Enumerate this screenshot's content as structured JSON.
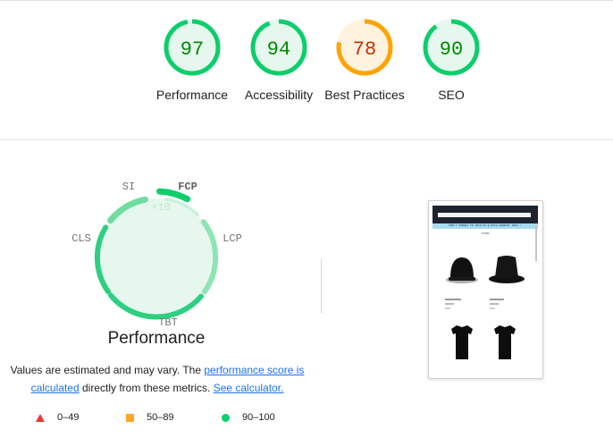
{
  "colors": {
    "pass": "#0cce6b",
    "pass_text": "#008800",
    "pass_bg": "#e6f8ee",
    "average": "#ffa400",
    "average_text": "#c33300",
    "average_bg": "#fff3e0",
    "fail": "#e53935"
  },
  "categories": [
    {
      "score": "97",
      "score_value": 97,
      "label": "Performance",
      "rating": "pass"
    },
    {
      "score": "94",
      "score_value": 94,
      "label": "Accessibility",
      "rating": "pass"
    },
    {
      "score": "78",
      "score_value": 78,
      "label": "Best Practices",
      "rating": "average"
    },
    {
      "score": "90",
      "score_value": 90,
      "label": "SEO",
      "rating": "pass"
    }
  ],
  "performance": {
    "title": "Performance",
    "metrics": {
      "si": "SI",
      "fcp": "FCP",
      "lcp": "LCP",
      "tbt": "TBT",
      "cls": "CLS"
    },
    "fcp_delta": "+10",
    "description": {
      "before": "Values are estimated and may vary. The ",
      "link1": "performance score is calculated",
      "middle": " directly from these metrics. ",
      "link2": "See calculator."
    }
  },
  "legend": [
    {
      "shape": "triangle-icon",
      "label": "0–49"
    },
    {
      "shape": "square-icon",
      "label": "50–89"
    },
    {
      "shape": "circle-icon",
      "label": "90–100"
    }
  ],
  "screenshot": {
    "banner": "DON'T FORGET TO JOIN US @ RICH JEWELRY 2024 !",
    "store_title": "STORE"
  }
}
